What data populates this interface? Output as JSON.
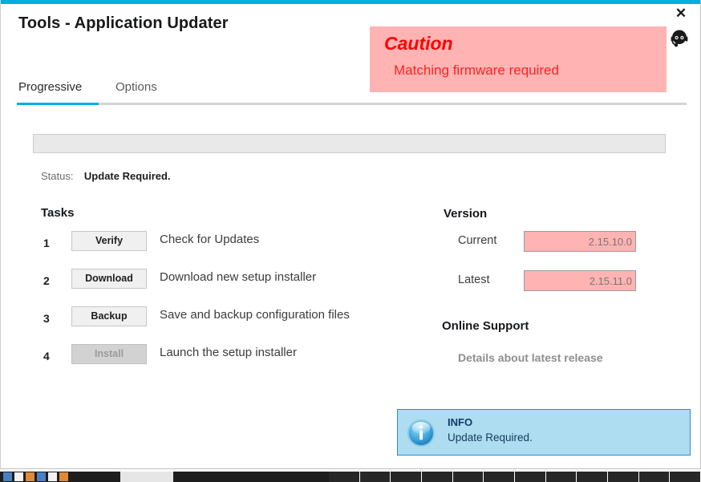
{
  "window": {
    "title": "Tools - Application Updater",
    "close_label": "✕",
    "accent_color": "#00aee0",
    "support_icon": "headset-support-icon"
  },
  "caution": {
    "title": "Caution",
    "message": "Matching firmware required",
    "background_color": "#ffb3b3",
    "text_color": "#ff0000"
  },
  "tabs": [
    {
      "label": "Progressive",
      "active": true
    },
    {
      "label": "Options",
      "active": false
    }
  ],
  "progress": {
    "value": 0,
    "display": "0%"
  },
  "status": {
    "label": "Status:",
    "value": "Update Required."
  },
  "tasks": {
    "heading": "Tasks",
    "items": [
      {
        "index": "1",
        "button": "Verify",
        "description": "Check for Updates",
        "disabled": false
      },
      {
        "index": "2",
        "button": "Download",
        "description": "Download new setup installer",
        "disabled": false
      },
      {
        "index": "3",
        "button": "Backup",
        "description": "Save and backup configuration files",
        "disabled": false
      },
      {
        "index": "4",
        "button": "Install",
        "description": "Launch the setup installer",
        "disabled": true
      }
    ]
  },
  "version": {
    "heading": "Version",
    "current_label": "Current",
    "current_value": "2.15.10.0",
    "latest_label": "Latest",
    "latest_value": "2.15.11.0",
    "field_color": "#ffb3b3"
  },
  "online_support": {
    "heading": "Online Support",
    "link_label": "Details about latest release"
  },
  "info_box": {
    "icon": "info-circle-icon",
    "title": "INFO",
    "message": "Update Required.",
    "background_color": "#aedcf0",
    "border_color": "#2e8fc0"
  }
}
